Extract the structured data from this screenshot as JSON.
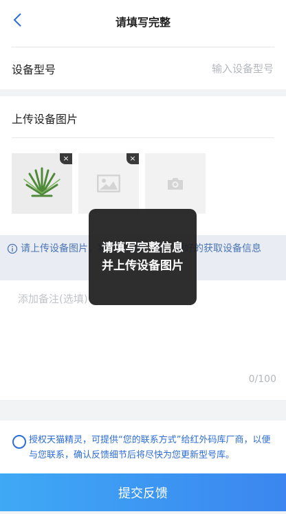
{
  "nav": {
    "title": "请填写完整"
  },
  "model": {
    "label": "设备型号",
    "placeholder": "输入设备型号"
  },
  "upload": {
    "label": "上传设备图片",
    "delete_glyph": "×"
  },
  "tip": {
    "text": "请上传设备图片，将更好的帮助我们更好的获取设备信息"
  },
  "remark": {
    "placeholder": "添加备注(选填)",
    "counter": "0/100"
  },
  "consent": {
    "text": "授权天猫精灵，可提供“您的联系方式”给红外码库厂商，以便与您联系，确认反馈细节后将尽快为您更新型号库。"
  },
  "submit": {
    "label": "提交反馈"
  },
  "toast": {
    "line1": "请填写完整信息",
    "line2": "并上传设备图片"
  },
  "colors": {
    "accent": "#2b6cd6",
    "button_start": "#3fa9f5",
    "button_end": "#3b86f0",
    "tip_text": "#4b76b5"
  },
  "icons": [
    "back-chevron-icon",
    "close-icon",
    "plant-photo",
    "image-placeholder-icon",
    "camera-icon",
    "info-icon",
    "radio-unchecked-icon"
  ]
}
